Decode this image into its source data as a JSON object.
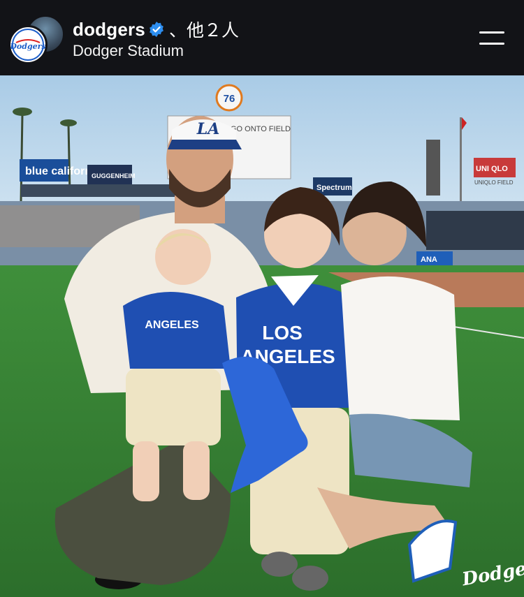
{
  "post": {
    "username": "dodgers",
    "coauthors": "、他２人",
    "location": "Dodger Stadium",
    "verified": true
  },
  "photo": {
    "boards": {
      "blue_shield": "blue california",
      "guggenheim": "GUGGENHEIM",
      "sign76": "76",
      "spectrum": "Spectrum",
      "uniqlo": "UNI QLO",
      "uniqlo_field": "UNIQLO FIELD",
      "ana": "ANA",
      "scoreboard_text": "GO ONTO FIELD"
    },
    "cap_logo": "LA",
    "baby_jersey": "ANGELES",
    "toddler_jersey_line1": "LOS",
    "toddler_jersey_line2": "ANGELES",
    "watermark": "Dodgers"
  },
  "colors": {
    "dodger_blue": "#1e5fc9",
    "verified_blue": "#2d8ef0",
    "header_bg": "#121317"
  },
  "icons": {
    "menu": "menu-icon",
    "verified": "verified-badge-icon"
  }
}
